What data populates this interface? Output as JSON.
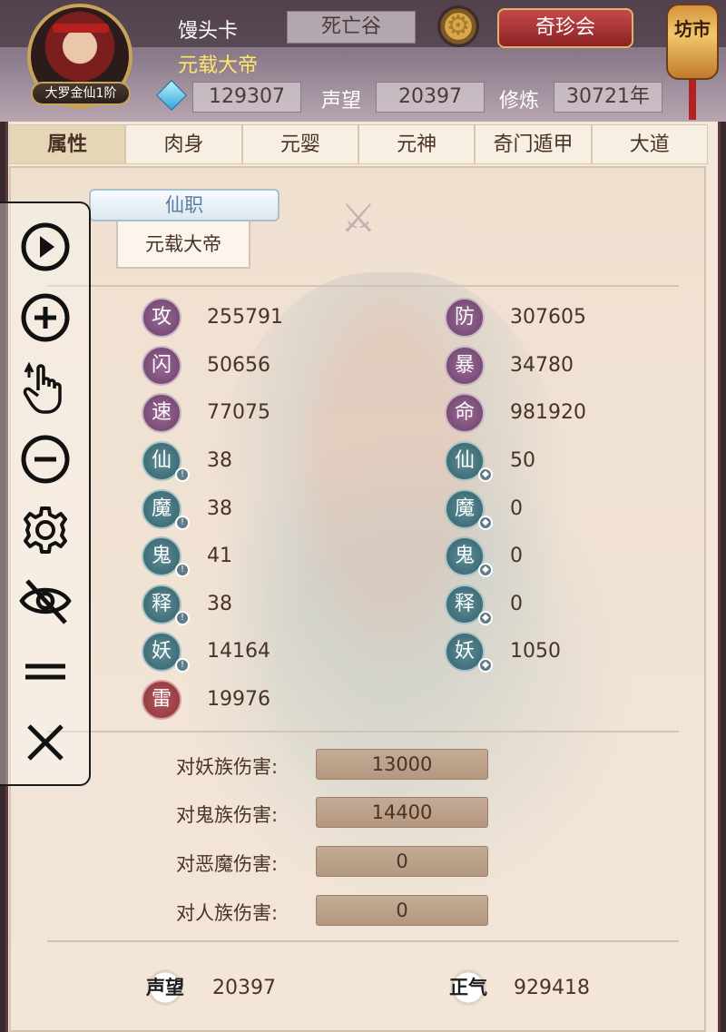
{
  "header": {
    "player_name": "馒头卡",
    "location": "死亡谷",
    "title": "元载大帝",
    "rank_badge": "大罗金仙1阶",
    "treasure_button": "奇珍会",
    "market_label": "坊市",
    "gems": "129307",
    "prestige_label": "声望",
    "prestige": "20397",
    "cultivation_label": "修炼",
    "cultivation": "30721年"
  },
  "tabs": [
    "属性",
    "肉身",
    "元婴",
    "元神",
    "奇门遁甲",
    "大道"
  ],
  "post": {
    "tag": "仙职",
    "value": "元载大帝"
  },
  "stats_left": [
    {
      "icon": "攻",
      "value": "255791"
    },
    {
      "icon": "闪",
      "value": "50656"
    },
    {
      "icon": "速",
      "value": "77075"
    },
    {
      "icon": "仙",
      "value": "38"
    },
    {
      "icon": "魔",
      "value": "38"
    },
    {
      "icon": "鬼",
      "value": "41"
    },
    {
      "icon": "释",
      "value": "38"
    },
    {
      "icon": "妖",
      "value": "14164"
    },
    {
      "icon": "雷",
      "value": "19976"
    }
  ],
  "stats_right": [
    {
      "icon": "防",
      "value": "307605"
    },
    {
      "icon": "暴",
      "value": "34780"
    },
    {
      "icon": "命",
      "value": "981920"
    },
    {
      "icon": "仙",
      "value": "50"
    },
    {
      "icon": "魔",
      "value": "0"
    },
    {
      "icon": "鬼",
      "value": "0"
    },
    {
      "icon": "释",
      "value": "0"
    },
    {
      "icon": "妖",
      "value": "1050"
    }
  ],
  "damage": [
    {
      "label": "对妖族伤害:",
      "value": "13000"
    },
    {
      "label": "对鬼族伤害:",
      "value": "14400"
    },
    {
      "label": "对恶魔伤害:",
      "value": "0"
    },
    {
      "label": "对人族伤害:",
      "value": "0"
    }
  ],
  "bottom_stats": [
    {
      "icon": "声望",
      "value": "20397"
    },
    {
      "icon": "正气",
      "value": "929418"
    }
  ],
  "toolbar": {
    "icons": [
      "play-icon",
      "zoom-in-icon",
      "tap-gesture-icon",
      "zoom-out-icon",
      "gear-icon",
      "hide-icon",
      "menu-icon",
      "close-icon"
    ]
  }
}
